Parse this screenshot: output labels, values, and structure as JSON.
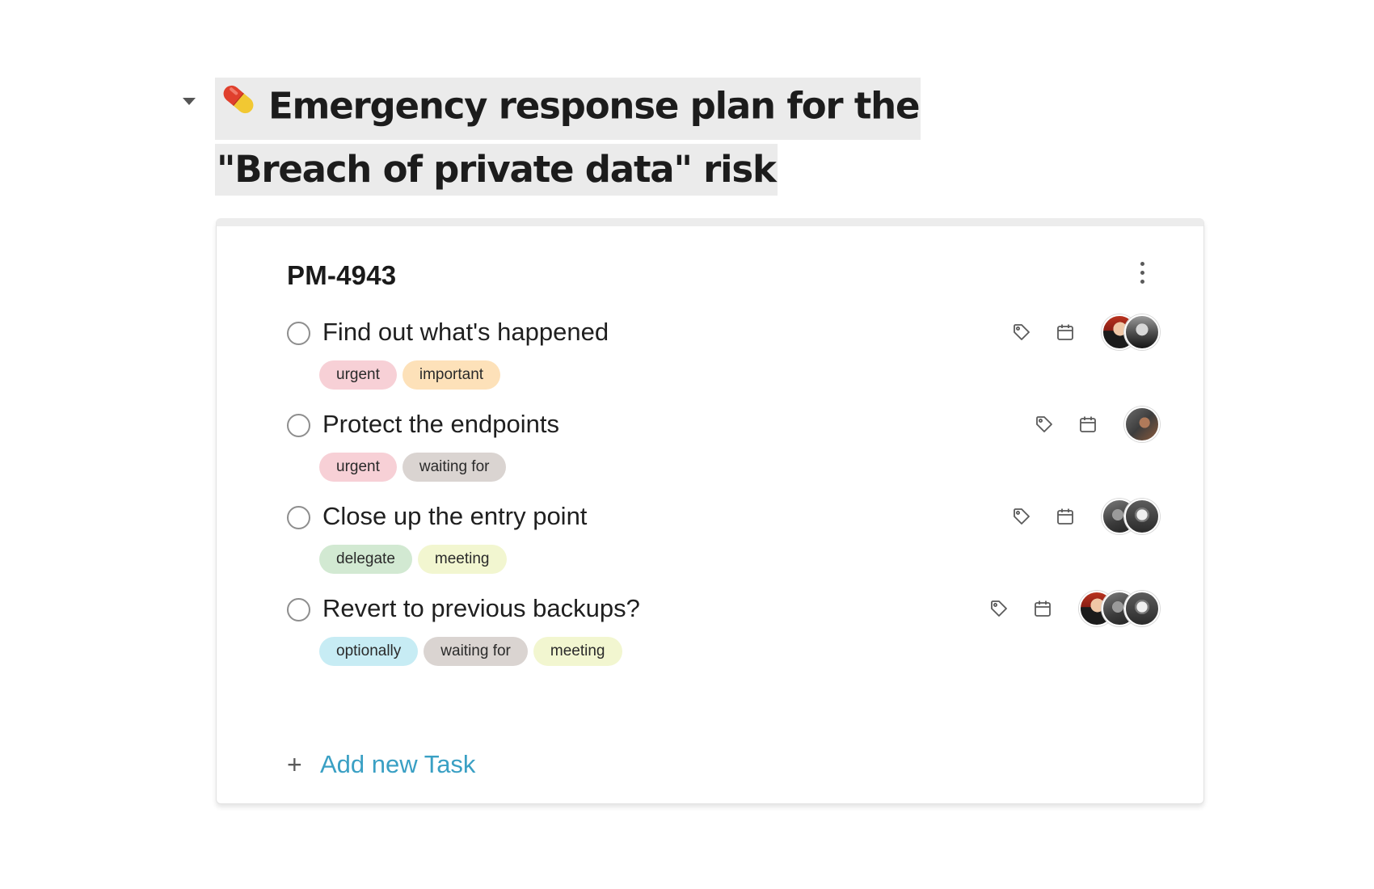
{
  "heading": {
    "line1": "Emergency response plan for the",
    "line2": "\"Breach of private data\" risk",
    "emoji_icon": "pill-icon"
  },
  "card": {
    "id": "PM-4943",
    "menu_icon": "more-vertical-icon",
    "tasks": [
      {
        "title": "Find out what's happened",
        "tags": [
          {
            "label": "urgent",
            "color": "#f7d0d6"
          },
          {
            "label": "important",
            "color": "#fde1b9"
          }
        ],
        "avatars": [
          "av-a",
          "av-b"
        ]
      },
      {
        "title": "Protect the endpoints",
        "tags": [
          {
            "label": "urgent",
            "color": "#f7d0d6"
          },
          {
            "label": "waiting for",
            "color": "#dad4d1"
          }
        ],
        "avatars": [
          "av-c"
        ]
      },
      {
        "title": "Close up the entry point",
        "tags": [
          {
            "label": "delegate",
            "color": "#d2e9d2"
          },
          {
            "label": "meeting",
            "color": "#f2f6d0"
          }
        ],
        "avatars": [
          "av-d",
          "av-e"
        ]
      },
      {
        "title": "Revert to previous backups?",
        "tags": [
          {
            "label": "optionally",
            "color": "#c7ecf4"
          },
          {
            "label": "waiting for",
            "color": "#dad4d1"
          },
          {
            "label": "meeting",
            "color": "#f2f6d0"
          }
        ],
        "avatars": [
          "av-a",
          "av-d",
          "av-e"
        ]
      }
    ],
    "add_task_label": "Add new Task",
    "add_icon": "+"
  },
  "colors": {
    "accent": "#3aa0c4",
    "title_highlight": "#ebebeb"
  }
}
